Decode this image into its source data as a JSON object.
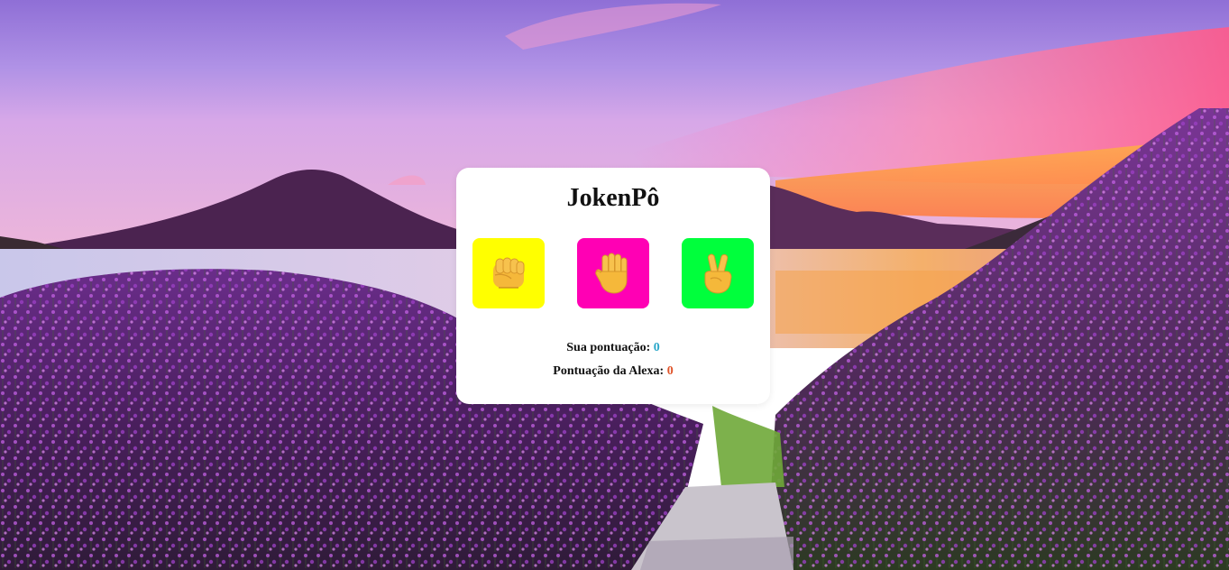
{
  "app": {
    "title": "JokenPô"
  },
  "choices": [
    {
      "id": "rock",
      "icon": "fist-icon",
      "color": "#ffff00"
    },
    {
      "id": "paper",
      "icon": "open-hand-icon",
      "color": "#ff00b4"
    },
    {
      "id": "scissors",
      "icon": "victory-hand-icon",
      "color": "#00ff3c"
    }
  ],
  "score": {
    "user_label": "Sua pontuação:",
    "user_value": "0",
    "user_value_color": "#2aa7c9",
    "alexa_label": "Pontuação da Alexa:",
    "alexa_value": "0",
    "alexa_value_color": "#e0542a"
  },
  "background": {
    "description_colors": {
      "sky_top": "#9a7fe0",
      "sunset": "#ff9a3c",
      "flowers": "#a23bbd"
    }
  }
}
